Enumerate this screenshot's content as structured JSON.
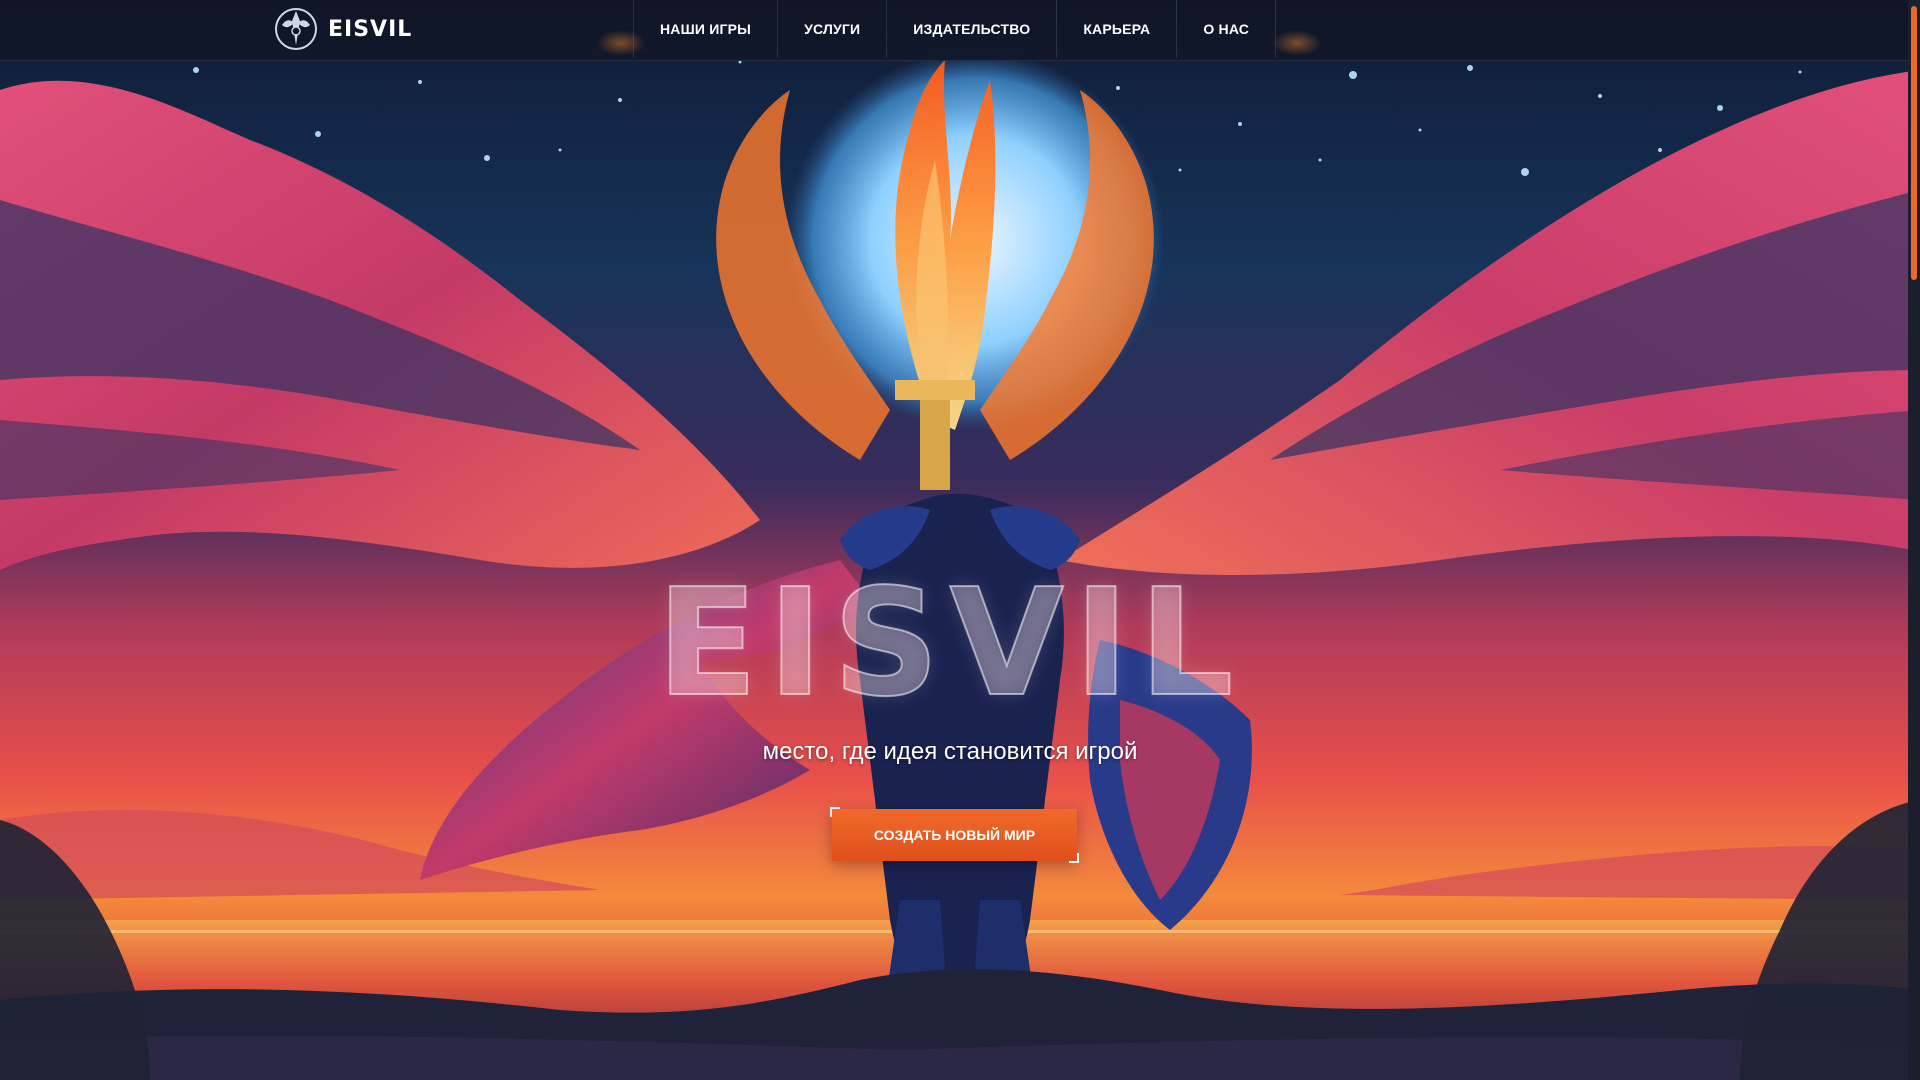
{
  "header": {
    "logo_text": "EISVIL",
    "nav": [
      {
        "label": "НАШИ ИГРЫ"
      },
      {
        "label": "УСЛУГИ"
      },
      {
        "label": "ИЗДАТЕЛЬСТВО"
      },
      {
        "label": "КАРЬЕРА"
      },
      {
        "label": "О НАС"
      }
    ]
  },
  "hero": {
    "title": "EISVIL",
    "subtitle": "место, где идея становится игрой",
    "cta_label": "СОЗДАТЬ НОВЫЙ МИР"
  },
  "colors": {
    "accent": "#ea6a2a",
    "header_bg": "#101626",
    "sky_top": "#132747",
    "sunset": "#f0813d"
  },
  "icons": {
    "logo": "crest-emblem-icon"
  },
  "scroll": {
    "position_fraction": 0
  }
}
